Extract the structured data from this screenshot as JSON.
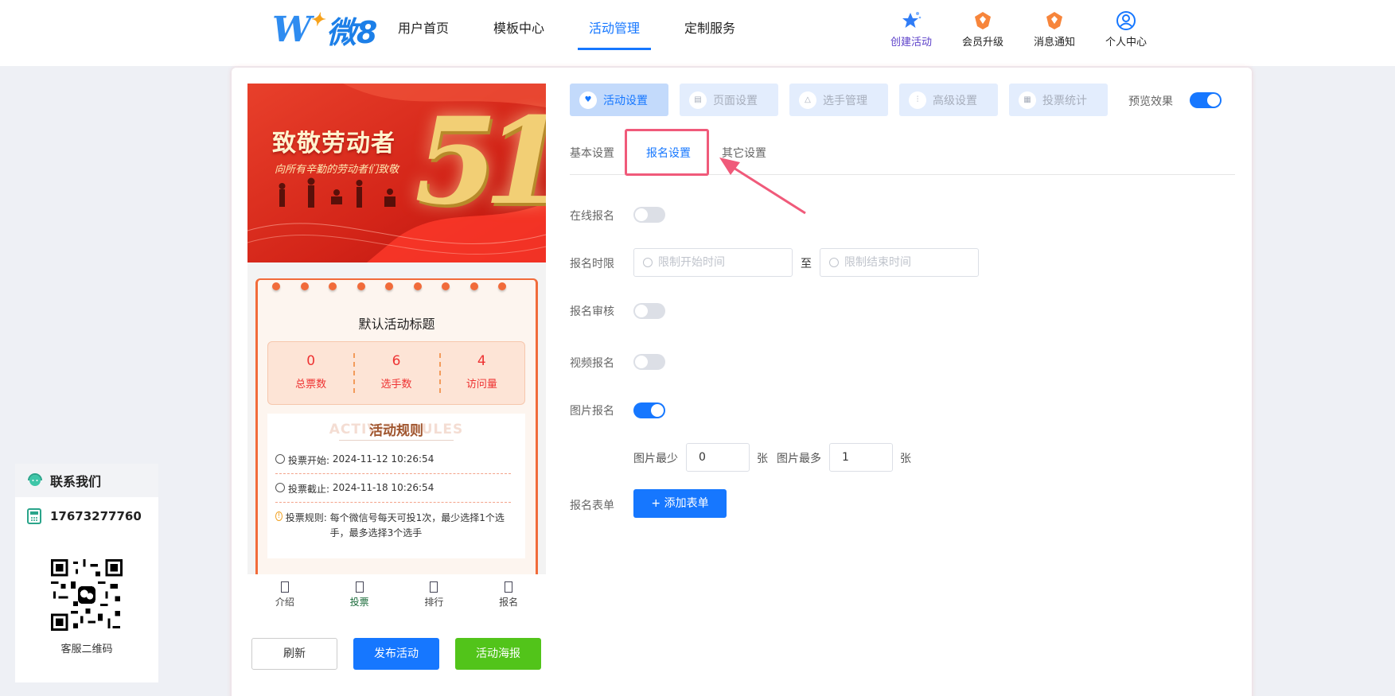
{
  "header": {
    "logo_text": "微8",
    "nav": [
      "用户首页",
      "模板中心",
      "活动管理",
      "定制服务"
    ],
    "active_nav": "活动管理",
    "icons": [
      {
        "label": "创建活动",
        "icon": "star-sparkle-icon"
      },
      {
        "label": "会员升级",
        "icon": "vip-badge-icon"
      },
      {
        "label": "消息通知",
        "icon": "notify-badge-icon"
      },
      {
        "label": "个人中心",
        "icon": "user-circle-icon"
      }
    ]
  },
  "preview": {
    "banner_title": "致敬劳动者",
    "banner_subtitle": "向所有辛勤的劳动者们致敬",
    "banner_number": "51",
    "activity_title": "默认活动标题",
    "stats": [
      {
        "value": "0",
        "label": "总票数"
      },
      {
        "value": "6",
        "label": "选手数"
      },
      {
        "value": "4",
        "label": "访问量"
      }
    ],
    "rules_title": "活动规则",
    "rules_title_bg": "ACTIVITY RULES",
    "vote_start_label": "投票开始:",
    "vote_start": "2024-11-12 10:26:54",
    "vote_end_label": "投票截止:",
    "vote_end": "2024-11-18 10:26:54",
    "vote_rule_label": "投票规则:",
    "vote_rule": "每个微信号每天可投1次，最少选择1个选手，最多选择3个选手",
    "tabs": [
      "介绍",
      "投票",
      "排行",
      "报名"
    ],
    "active_tab": "投票"
  },
  "actions": {
    "refresh": "刷新",
    "publish": "发布活动",
    "poster": "活动海报"
  },
  "top_tabs": [
    "活动设置",
    "页面设置",
    "选手管理",
    "高级设置",
    "投票统计"
  ],
  "active_top_tab": "活动设置",
  "preview_effect": {
    "label": "预览效果",
    "on": true
  },
  "sub_tabs": [
    "基本设置",
    "报名设置",
    "其它设置"
  ],
  "active_sub_tab": "报名设置",
  "form": {
    "online_signup": {
      "label": "在线报名",
      "on": false
    },
    "time_limit": {
      "label": "报名时限",
      "start_placeholder": "限制开始时间",
      "separator": "至",
      "end_placeholder": "限制结束时间"
    },
    "review": {
      "label": "报名审核",
      "on": false
    },
    "video_signup": {
      "label": "视频报名",
      "on": false
    },
    "image_signup": {
      "label": "图片报名",
      "on": true
    },
    "image_min_label": "图片最少",
    "image_min": "0",
    "image_unit": "张",
    "image_max_label": "图片最多",
    "image_max": "1",
    "signup_form_label": "报名表单",
    "add_form_button": "+ 添加表单"
  },
  "contact": {
    "title": "联系我们",
    "phone": "17673277760",
    "qr_label": "客服二维码"
  },
  "colors": {
    "primary": "#1677ff",
    "success": "#52c41a",
    "highlight": "#f05a7a",
    "banner_red": "#d9261c"
  }
}
